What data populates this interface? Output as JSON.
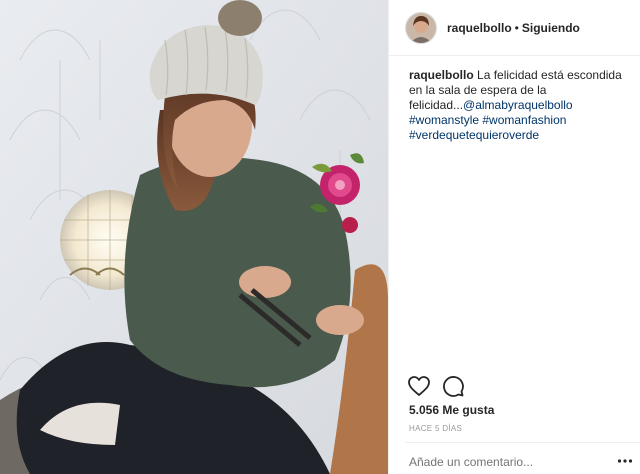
{
  "post": {
    "username": "raquelbollo",
    "separator": "•",
    "follow_status": "Siguiendo",
    "caption": {
      "username": "raquelbollo",
      "text": "La felicidad está escondida en la sala de espera de la felicidad...",
      "mention": "@almabyraquelbollo",
      "hashtags": [
        "#womanstyle",
        "#womanfashion",
        "#verdequetequieroverde"
      ]
    },
    "likes": "5.056 Me gusta",
    "time": "HACE 5 DÍAS",
    "comment_placeholder": "Añade un comentario..."
  },
  "icons": {
    "like": "heart-icon",
    "comment": "comment-bubble-icon",
    "more": "more-options-icon"
  },
  "colors": {
    "link": "#003569",
    "text": "#262626",
    "muted": "#999999",
    "sweater": "#4a5a4c"
  }
}
